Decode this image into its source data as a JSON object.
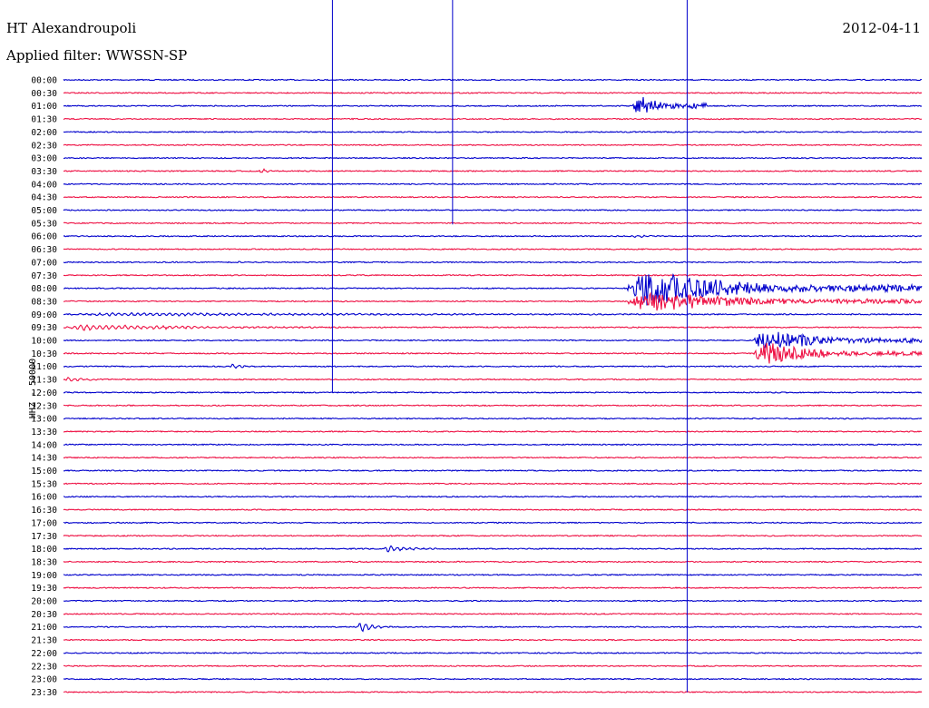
{
  "header": {
    "station": "HT Alexandroupoli",
    "date": "2012-04-11",
    "filter_label": "Applied filter:",
    "filter_value": "WWSSN-SP"
  },
  "side_label": "HHZ - 50000",
  "colors": {
    "trace_a": "#0000cc",
    "trace_b": "#ee1144"
  },
  "chart_data": {
    "type": "line",
    "rows": [
      "00:00",
      "00:30",
      "01:00",
      "01:30",
      "02:00",
      "02:30",
      "03:00",
      "03:30",
      "04:00",
      "04:30",
      "05:00",
      "05:30",
      "06:00",
      "06:30",
      "07:00",
      "07:30",
      "08:00",
      "08:30",
      "09:00",
      "09:30",
      "10:00",
      "10:30",
      "11:00",
      "11:30",
      "12:00",
      "12:30",
      "13:00",
      "13:30",
      "14:00",
      "14:30",
      "15:00",
      "15:30",
      "16:00",
      "16:30",
      "17:00",
      "17:30",
      "18:00",
      "18:30",
      "19:00",
      "19:30",
      "20:00",
      "20:30",
      "21:00",
      "21:30",
      "22:00",
      "22:30",
      "23:00",
      "23:30"
    ],
    "x_range_minutes": [
      0,
      30
    ],
    "grid": false,
    "events": [
      {
        "row": 2,
        "minute_start": 19.9,
        "minute_end": 22.5,
        "amplitude": 0.95
      },
      {
        "row": 7,
        "minute_start": 6.8,
        "minute_end": 7.9,
        "amplitude": 0.2
      },
      {
        "row": 12,
        "minute_start": 19.9,
        "minute_end": 21.2,
        "amplitude": 0.12
      },
      {
        "row": 14,
        "minute_start": 6.0,
        "minute_end": 7.0,
        "amplitude": 0.05
      },
      {
        "row": 16,
        "minute_start": 19.7,
        "minute_end": 30.0,
        "amplitude": 1.4
      },
      {
        "row": 17,
        "minute_start": 19.7,
        "minute_end": 30.0,
        "amplitude": 0.9
      },
      {
        "row": 18,
        "minute_start": 0.0,
        "minute_end": 30.0,
        "amplitude": 0.12
      },
      {
        "row": 19,
        "minute_start": 0.0,
        "minute_end": 12.0,
        "amplitude": 0.22
      },
      {
        "row": 20,
        "minute_start": 24.1,
        "minute_end": 30.0,
        "amplitude": 0.9
      },
      {
        "row": 21,
        "minute_start": 24.1,
        "minute_end": 30.0,
        "amplitude": 0.9
      },
      {
        "row": 22,
        "minute_start": 5.8,
        "minute_end": 6.8,
        "amplitude": 0.25
      },
      {
        "row": 23,
        "minute_start": 0.0,
        "minute_end": 2.0,
        "amplitude": 0.15
      },
      {
        "row": 36,
        "minute_start": 11.2,
        "minute_end": 13.2,
        "amplitude": 0.3
      },
      {
        "row": 42,
        "minute_start": 10.3,
        "minute_end": 11.5,
        "amplitude": 0.55
      }
    ],
    "spikes": [
      {
        "row": 6,
        "minute": 13.6,
        "extent": 5.1
      },
      {
        "row": 16,
        "minute": 9.4,
        "extent": 8.0
      },
      {
        "row": 36,
        "minute": 21.8,
        "extent": 11.0
      }
    ]
  }
}
